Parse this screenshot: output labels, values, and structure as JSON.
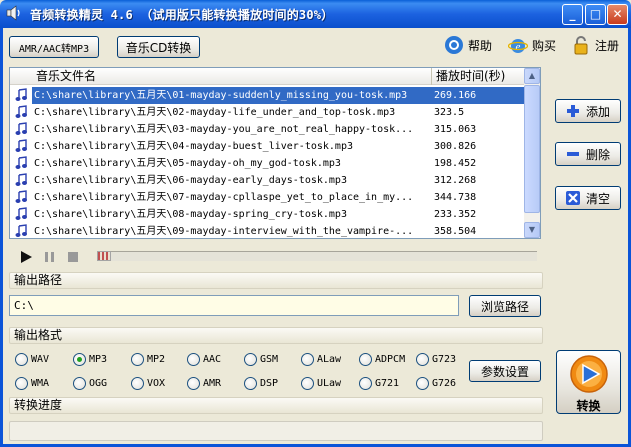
{
  "window": {
    "title": "音频转换精灵 4.6 （试用版只能转换播放时间的30%）"
  },
  "toolbar": {
    "amr_aac_label": "AMR/AAC转MP3",
    "music_cd_label": "音乐CD转换",
    "help_label": "帮助",
    "buy_label": "购买",
    "register_label": "注册"
  },
  "file_list": {
    "columns": [
      "音乐文件名",
      "播放时间(秒)"
    ],
    "rows": [
      {
        "name": "C:\\share\\library\\五月天\\01-mayday-suddenly_missing_you-tosk.mp3",
        "duration": "269.166"
      },
      {
        "name": "C:\\share\\library\\五月天\\02-mayday-life_under_and_top-tosk.mp3",
        "duration": "323.5"
      },
      {
        "name": "C:\\share\\library\\五月天\\03-mayday-you_are_not_real_happy-tosk...",
        "duration": "315.063"
      },
      {
        "name": "C:\\share\\library\\五月天\\04-mayday-buest_liver-tosk.mp3",
        "duration": "300.826"
      },
      {
        "name": "C:\\share\\library\\五月天\\05-mayday-oh_my_god-tosk.mp3",
        "duration": "198.452"
      },
      {
        "name": "C:\\share\\library\\五月天\\06-mayday-early_days-tosk.mp3",
        "duration": "312.268"
      },
      {
        "name": "C:\\share\\library\\五月天\\07-mayday-cpllaspe_yet_to_place_in_my...",
        "duration": "344.738"
      },
      {
        "name": "C:\\share\\library\\五月天\\08-mayday-spring_cry-tosk.mp3",
        "duration": "233.352"
      },
      {
        "name": "C:\\share\\library\\五月天\\09-mayday-interview_with_the_vampire-...",
        "duration": "358.504"
      }
    ]
  },
  "side_buttons": {
    "add_label": "添加",
    "delete_label": "删除",
    "clear_label": "清空"
  },
  "output_path": {
    "section_label": "输出路径",
    "value": "C:\\",
    "browse_label": "浏览路径"
  },
  "output_format": {
    "section_label": "输出格式",
    "options_row1": [
      "WAV",
      "MP3",
      "MP2",
      "AAC",
      "GSM",
      "ALaw",
      "ADPCM",
      "G723"
    ],
    "options_row2": [
      "WMA",
      "OGG",
      "VOX",
      "AMR",
      "DSP",
      "ULaw",
      "G721",
      "G726"
    ],
    "selected": "MP3",
    "settings_label": "参数设置"
  },
  "progress": {
    "section_label": "转换进度",
    "value": 0
  },
  "convert": {
    "label": "转换"
  },
  "colors": {
    "title_bar": "#0a5fd7",
    "selection": "#316ac5",
    "accent_green": "#21a121"
  }
}
